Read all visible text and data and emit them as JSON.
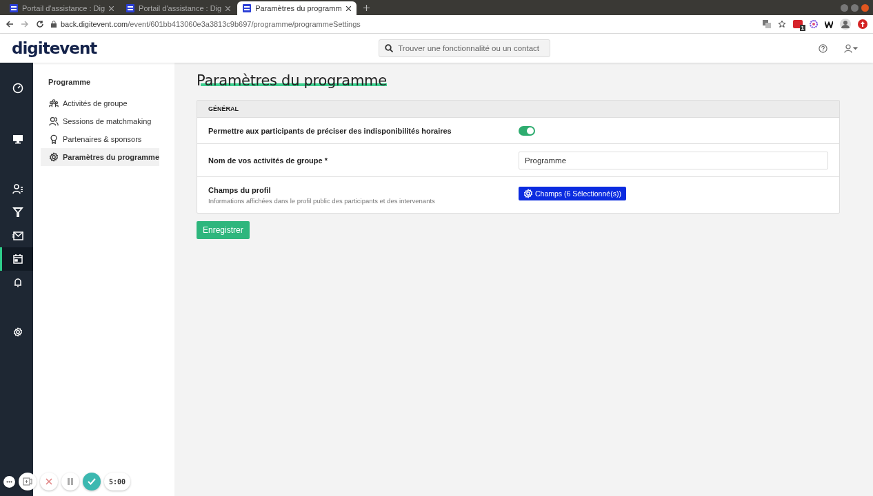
{
  "browser": {
    "tabs": [
      {
        "title": "Portail d'assistance : Dig",
        "selected": false
      },
      {
        "title": "Portail d'assistance : Dig",
        "selected": false
      },
      {
        "title": "Paramètres du programm",
        "selected": true
      }
    ],
    "url_host": "back.digitevent.com",
    "url_path": "/event/601bb413060e3a3813c9b697/programme/programmeSettings",
    "extension_badge": "1"
  },
  "header": {
    "logo": "digitevent",
    "search": {
      "placeholder": "Trouver une fonctionnalité ou un contact"
    }
  },
  "rail": [
    {
      "selected": false
    },
    {
      "selected": false
    },
    {
      "selected": false
    },
    {
      "selected": false
    },
    {
      "selected": false
    },
    {
      "selected": true
    },
    {
      "selected": false
    },
    {
      "selected": false
    }
  ],
  "sidebar": {
    "heading": "Programme",
    "items": [
      {
        "label": "Activités de groupe",
        "selected": false
      },
      {
        "label": "Sessions de matchmaking",
        "selected": false
      },
      {
        "label": "Partenaires & sponsors",
        "selected": false
      },
      {
        "label": "Paramètres du programme",
        "selected": true
      }
    ]
  },
  "page": {
    "title": "Paramètres du programme",
    "section": "GÉNÉRAL",
    "rows": [
      {
        "kind": "toggle",
        "label": "Permettre aux participants de préciser des indisponibilités horaires",
        "on": true
      },
      {
        "kind": "text",
        "label": "Nom de vos activités de groupe *",
        "value": "Programme"
      },
      {
        "kind": "button",
        "label": "Champs du profil",
        "description": "Informations affichées dans le profil public des participants et des intervenants",
        "button": "Champs (6 Sélectionné(s))"
      }
    ],
    "save": "Enregistrer"
  },
  "recorder": {
    "timer": "5:00"
  }
}
